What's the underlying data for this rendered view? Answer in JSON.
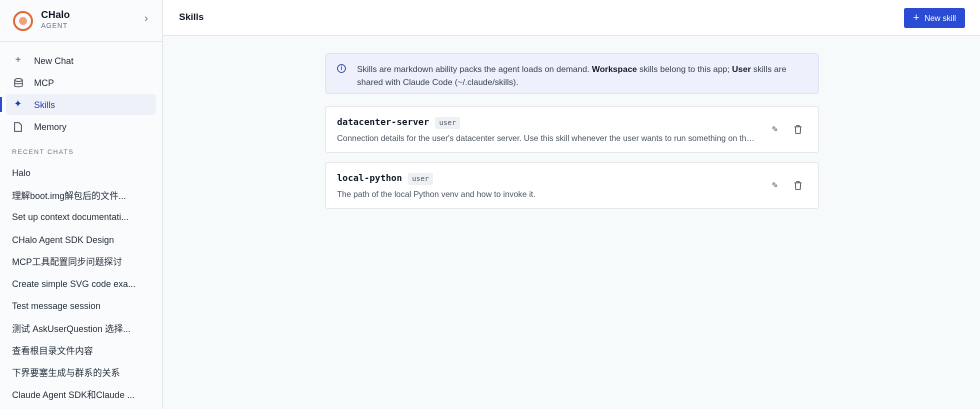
{
  "brand": {
    "name": "CHalo",
    "subtitle": "AGENT"
  },
  "nav": [
    {
      "icon": "plus-icon",
      "label": "New Chat"
    },
    {
      "icon": "database-icon",
      "label": "MCP"
    },
    {
      "icon": "sparkle-icon",
      "label": "Skills",
      "active": true
    },
    {
      "icon": "file-icon",
      "label": "Memory"
    }
  ],
  "recent": {
    "title": "RECENT CHATS",
    "items": [
      "Halo",
      "理解boot.img解包后的文件...",
      "Set up context documentati...",
      "CHalo Agent SDK Design",
      "MCP工具配置同步问题探讨",
      "Create simple SVG code exa...",
      "Test message session",
      "测试 AskUserQuestion 选择...",
      "查看根目录文件内容",
      "下界要塞生成与群系的关系",
      "Claude Agent SDK和Claude ..."
    ]
  },
  "header": {
    "title": "Skills",
    "new_button": "New skill"
  },
  "banner": {
    "part1": "Skills are markdown ability packs the agent loads on demand. ",
    "bold1": "Workspace",
    "part2": " skills belong to this app; ",
    "bold2": "User",
    "part3": " skills are shared with Claude Code (~/.claude/skills)."
  },
  "skills": [
    {
      "name": "datacenter-server",
      "scope": "user",
      "description": "Connection details for the user's datacenter server. Use this skill whenever the user wants to run something on the datacenter server."
    },
    {
      "name": "local-python",
      "scope": "user",
      "description": "The path of the local Python venv and how to invoke it."
    }
  ],
  "colors": {
    "accent": "#2a4bd3",
    "banner_bg": "#eef1fb",
    "logo": "#e06a3b"
  }
}
